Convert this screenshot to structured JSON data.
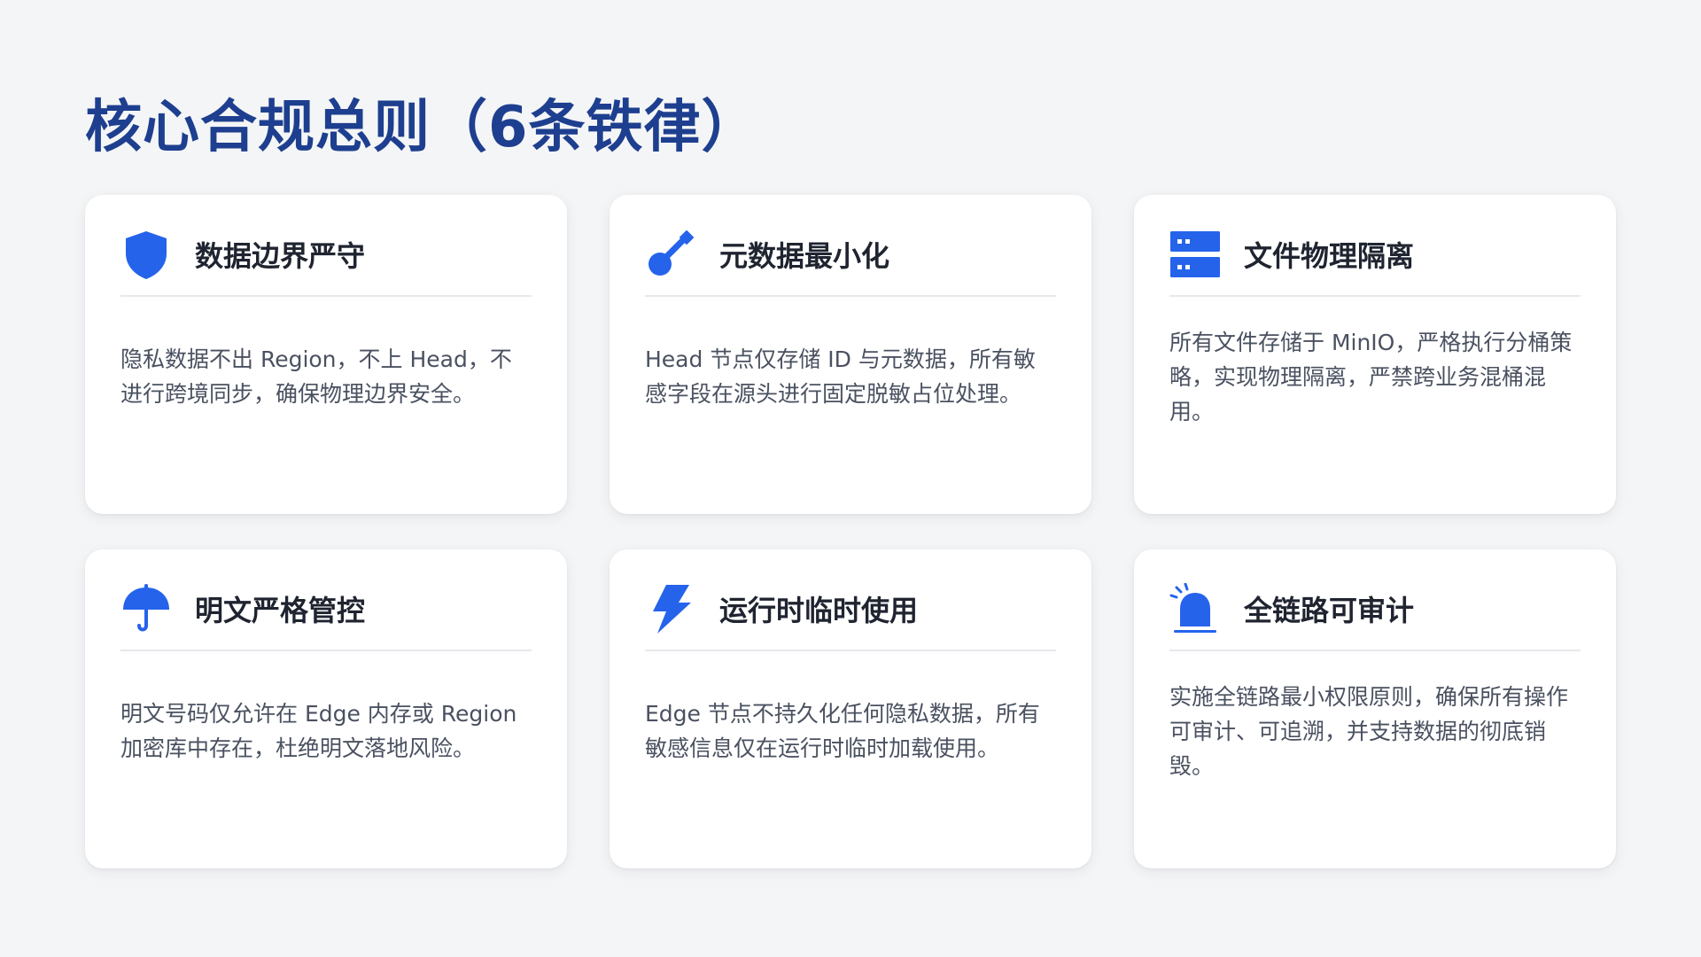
{
  "page": {
    "title": "核心合规总则（6条铁律）"
  },
  "theme": {
    "title_color": "#1e3f8f",
    "accent_color": "#2563eb"
  },
  "cards": [
    {
      "icon": "shield-icon",
      "title": "数据边界严守",
      "desc": "隐私数据不出 Region，不上 Head，不进行跨境同步，确保物理边界安全。"
    },
    {
      "icon": "key-icon",
      "title": "元数据最小化",
      "desc": "Head 节点仅存储 ID 与元数据，所有敏感字段在源头进行固定脱敏占位处理。"
    },
    {
      "icon": "server-icon",
      "title": "文件物理隔离",
      "desc": "所有文件存储于 MinIO，严格执行分桶策略，实现物理隔离，严禁跨业务混桶混用。"
    },
    {
      "icon": "umbrella-icon",
      "title": "明文严格管控",
      "desc": "明文号码仅允许在 Edge 内存或 Region 加密库中存在，杜绝明文落地风险。"
    },
    {
      "icon": "lightning-icon",
      "title": "运行时临时使用",
      "desc": "Edge 节点不持久化任何隐私数据，所有敏感信息仅在运行时临时加载使用。"
    },
    {
      "icon": "alarm-icon",
      "title": "全链路可审计",
      "desc": "实施全链路最小权限原则，确保所有操作可审计、可追溯，并支持数据的彻底销毁。"
    }
  ]
}
